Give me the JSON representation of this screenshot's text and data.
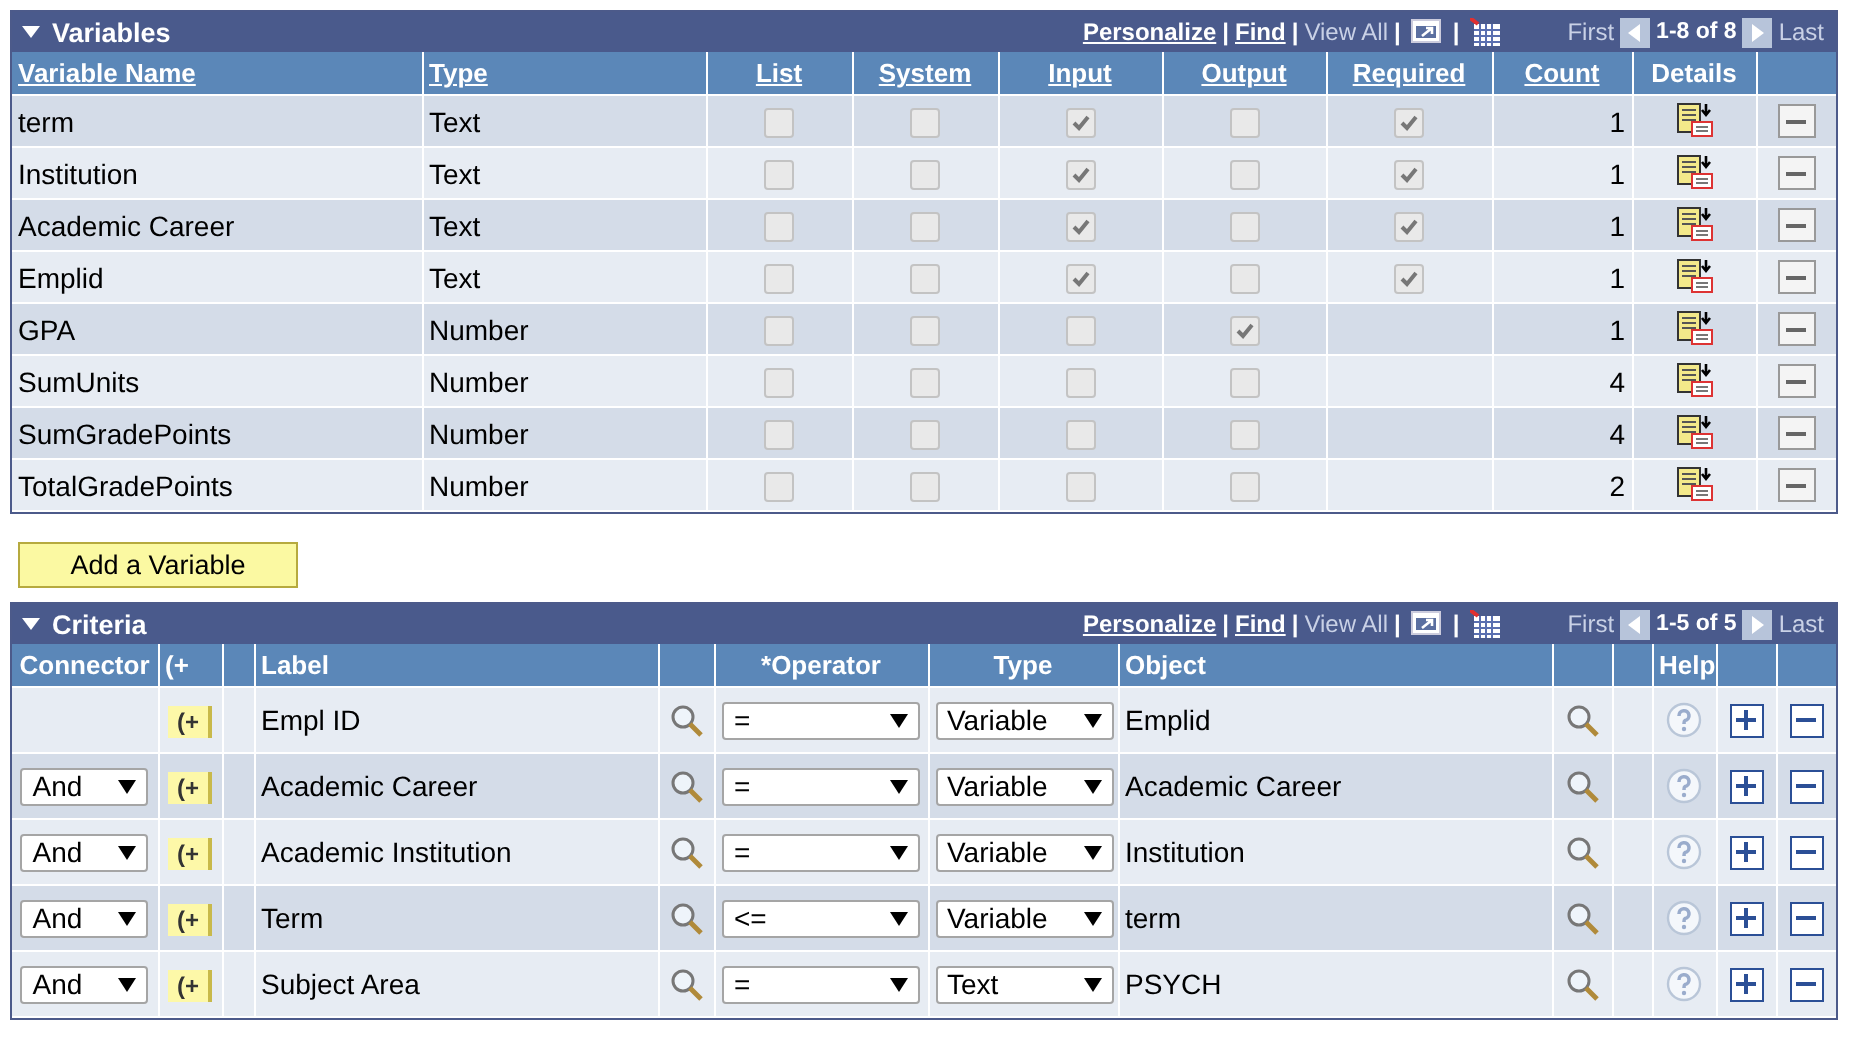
{
  "variables": {
    "title": "Variables",
    "nav": [
      {
        "kind": "link",
        "text": "Personalize"
      },
      {
        "kind": "sep",
        "text": "|"
      },
      {
        "kind": "link",
        "text": "Find"
      },
      {
        "kind": "sep",
        "text": "|"
      },
      {
        "kind": "text",
        "text": "View All"
      },
      {
        "kind": "sep",
        "text": "|"
      },
      {
        "kind": "zoom"
      },
      {
        "kind": "sep",
        "text": "|"
      },
      {
        "kind": "grid"
      }
    ],
    "pager": {
      "first": "First",
      "range": "1-8 of 8",
      "last": "Last"
    },
    "columns": [
      "Variable Name",
      "Type",
      "List",
      "System",
      "Input",
      "Output",
      "Required",
      "Count",
      "Details"
    ],
    "rows": [
      {
        "name": "term",
        "type": "Text",
        "list": false,
        "system": false,
        "input": true,
        "output": false,
        "required": true,
        "count": "1"
      },
      {
        "name": "Institution",
        "type": "Text",
        "list": false,
        "system": false,
        "input": true,
        "output": false,
        "required": true,
        "count": "1"
      },
      {
        "name": "Academic Career",
        "type": "Text",
        "list": false,
        "system": false,
        "input": true,
        "output": false,
        "required": true,
        "count": "1"
      },
      {
        "name": "Emplid",
        "type": "Text",
        "list": false,
        "system": false,
        "input": true,
        "output": false,
        "required": true,
        "count": "1"
      },
      {
        "name": "GPA",
        "type": "Number",
        "list": false,
        "system": false,
        "input": false,
        "output": true,
        "count": "1"
      },
      {
        "name": "SumUnits",
        "type": "Number",
        "list": false,
        "system": false,
        "input": false,
        "output": false,
        "count": "4"
      },
      {
        "name": "SumGradePoints",
        "type": "Number",
        "list": false,
        "system": false,
        "input": false,
        "output": false,
        "count": "4"
      },
      {
        "name": "TotalGradePoints",
        "type": "Number",
        "list": false,
        "system": false,
        "input": false,
        "output": false,
        "count": "2"
      }
    ]
  },
  "add_button": "Add a Variable",
  "criteria": {
    "title": "Criteria",
    "nav": [
      {
        "kind": "link",
        "text": "Personalize"
      },
      {
        "kind": "sep",
        "text": "|"
      },
      {
        "kind": "link",
        "text": "Find"
      },
      {
        "kind": "sep",
        "text": "|"
      },
      {
        "kind": "text",
        "text": "View All"
      },
      {
        "kind": "sep",
        "text": "|"
      },
      {
        "kind": "zoom"
      },
      {
        "kind": "sep",
        "text": "|"
      },
      {
        "kind": "grid"
      }
    ],
    "pager": {
      "first": "First",
      "range": "1-5 of 5",
      "last": "Last"
    },
    "columns": [
      "Connector",
      "(+",
      "Label",
      "*Operator",
      "Type",
      "Object",
      "Help"
    ],
    "rows": [
      {
        "paren": "(+",
        "label": "Empl ID",
        "operator": "=",
        "type": "Variable",
        "object": "Emplid"
      },
      {
        "connector": "And",
        "paren": "(+",
        "label": "Academic Career",
        "operator": "=",
        "type": "Variable",
        "object": "Academic Career"
      },
      {
        "connector": "And",
        "paren": "(+",
        "label": "Academic Institution",
        "operator": "=",
        "type": "Variable",
        "object": "Institution"
      },
      {
        "connector": "And",
        "paren": "(+",
        "label": "Term",
        "operator": "<=",
        "type": "Variable",
        "object": "term"
      },
      {
        "connector": "And",
        "paren": "(+",
        "label": "Subject Area",
        "operator": "=",
        "type": "Text",
        "object": "PSYCH"
      }
    ]
  }
}
